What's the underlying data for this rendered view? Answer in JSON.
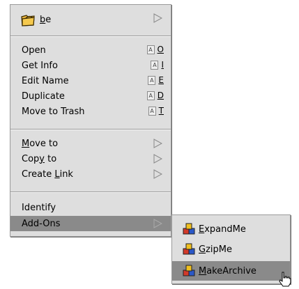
{
  "main_menu": {
    "header": {
      "label": "be",
      "underline_letter": "b",
      "rest": "e"
    },
    "group1": [
      {
        "label": "Open",
        "mod": "A",
        "key": "O"
      },
      {
        "label": "Get Info",
        "mod": "A",
        "key": "I"
      },
      {
        "label": "Edit Name",
        "mod": "A",
        "key": "E"
      },
      {
        "label": "Duplicate",
        "mod": "A",
        "key": "D"
      },
      {
        "label": "Move to Trash",
        "mod": "A",
        "key": "T"
      }
    ],
    "group2": [
      {
        "pre": "",
        "u": "M",
        "post": "ove to"
      },
      {
        "pre": "Cop",
        "u": "y",
        "post": " to"
      },
      {
        "pre": "Create ",
        "u": "L",
        "post": "ink"
      }
    ],
    "group3": [
      {
        "label": "Identify"
      },
      {
        "label": "Add-Ons"
      }
    ]
  },
  "submenu": {
    "items": [
      {
        "pre": "",
        "u": "E",
        "post": "xpandMe"
      },
      {
        "pre": "",
        "u": "G",
        "post": "zipMe"
      },
      {
        "pre": "",
        "u": "M",
        "post": "akeArchive"
      }
    ]
  },
  "colors": {
    "menu_bg": "#dedede",
    "highlight": "#8a8a8a",
    "border": "#9a9a9a"
  }
}
